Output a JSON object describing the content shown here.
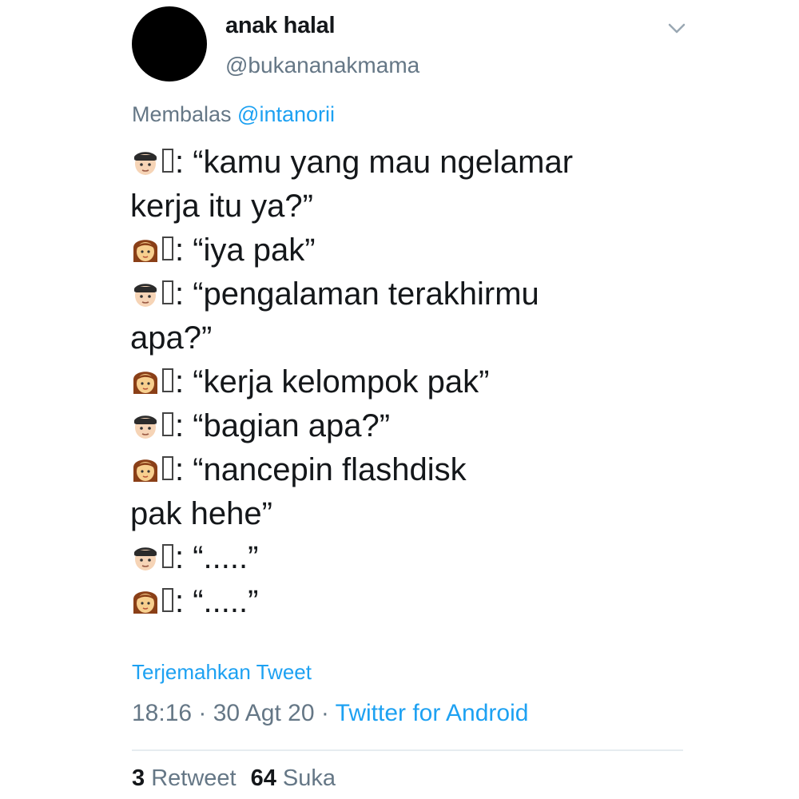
{
  "tweet": {
    "display_name": "anak halal",
    "handle": "@bukananakmama",
    "reply_prefix": "Membalas ",
    "reply_mention": "@intanorii",
    "lines": [
      {
        "speaker": "man",
        "text": ": “kamu yang mau ngelamar"
      },
      {
        "speaker": null,
        "text": "kerja itu ya?”"
      },
      {
        "speaker": "woman",
        "text": ": “iya pak”"
      },
      {
        "speaker": "man",
        "text": ": “pengalaman terakhirmu"
      },
      {
        "speaker": null,
        "text": "apa?”"
      },
      {
        "speaker": "woman",
        "text": ": “kerja kelompok pak”"
      },
      {
        "speaker": "man",
        "text": ": “bagian apa?”"
      },
      {
        "speaker": "woman",
        "text": ": “nancepin flashdisk"
      },
      {
        "speaker": null,
        "text": "pak hehe”"
      },
      {
        "speaker": "man",
        "text": ": “.....”"
      },
      {
        "speaker": "woman",
        "text": ": “.....”"
      }
    ],
    "translate_label": "Terjemahkan Tweet",
    "time": "18:16",
    "separator": " · ",
    "date": "30 Agt 20",
    "source": "Twitter for Android",
    "retweet_count": "3",
    "retweet_label": "Retweet",
    "like_count": "64",
    "like_label": "Suka"
  },
  "icons": {
    "man": "man-face-icon",
    "woman": "woman-face-icon",
    "menu": "chevron-down-icon"
  },
  "colors": {
    "text": "#14171a",
    "secondary": "#657786",
    "link": "#1da1f2",
    "divider": "#e6ecf0"
  }
}
